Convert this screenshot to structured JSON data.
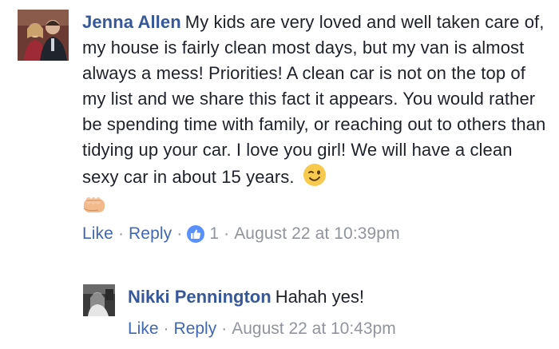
{
  "comments": [
    {
      "author": "Jenna Allen",
      "text": "My kids are very loved and well taken care of, my house is fairly clean most days, but my van is almost always a mess! Priorities! A clean car is not on the top of my list and we share this fact it appears. You would rather be spending time with family, or reaching out to others than tidying up your car. I love you girl! We will have a clean sexy car in about 15 years.",
      "emoji": [
        "wink-emoji-icon",
        "fist-bump-emoji-icon"
      ],
      "like_label": "Like",
      "reply_label": "Reply",
      "reaction_icon": "thumbs-up-icon",
      "reaction_count": "1",
      "timestamp": "August 22 at 10:39pm"
    },
    {
      "author": "Nikki Pennington",
      "text": "Hahah yes!",
      "like_label": "Like",
      "reply_label": "Reply",
      "timestamp": "August 22 at 10:43pm"
    }
  ],
  "separator": "·",
  "colors": {
    "author_link": "#365899",
    "action_link": "#4267b2",
    "meta_text": "#90949c",
    "body_text": "#1d2129",
    "like_badge": "#5890ff",
    "emoji_yellow": "#f7c94c"
  }
}
